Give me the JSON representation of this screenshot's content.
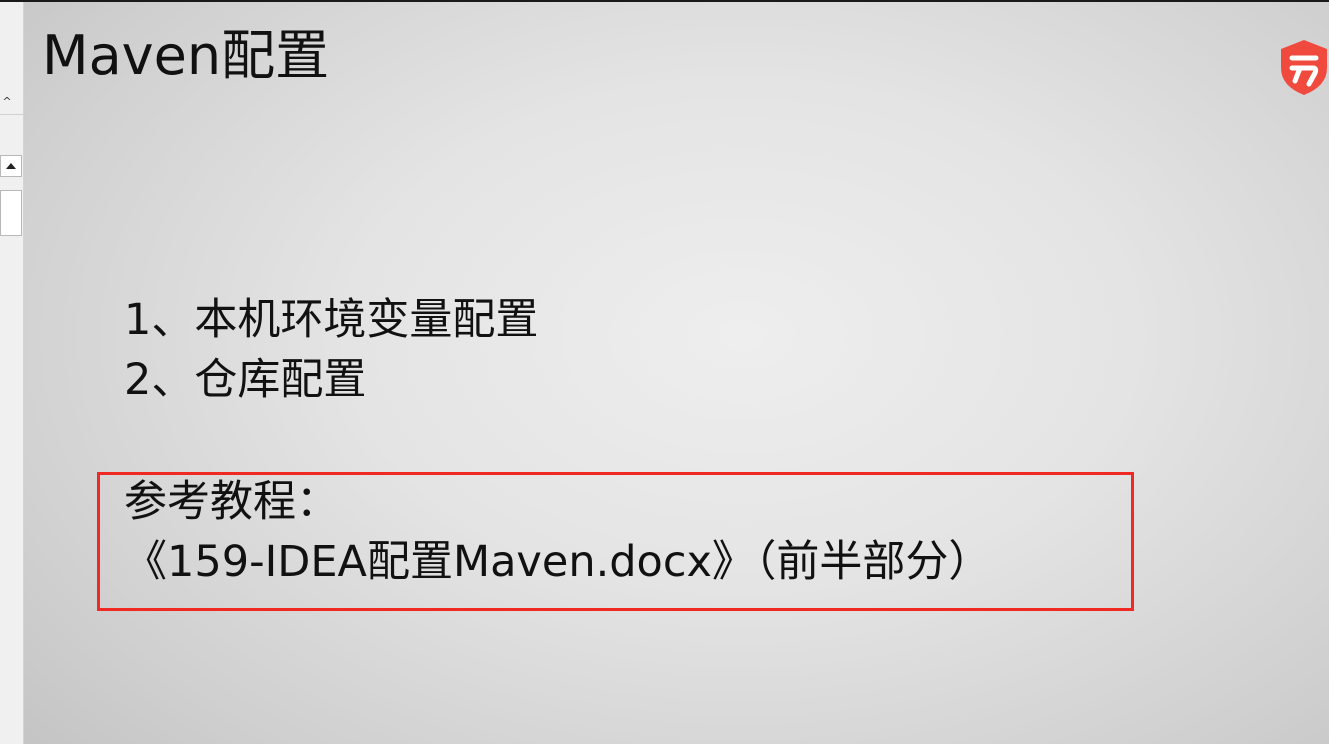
{
  "slide": {
    "title": "Maven配置",
    "items": [
      "1、本机环境变量配置",
      "2、仓库配置"
    ],
    "reference": {
      "label": "参考教程：",
      "document": "《159-IDEA配置Maven.docx》（前半部分）"
    }
  },
  "left_panel": {
    "collapse_glyph": "^"
  },
  "logo": {
    "icon": "shield-logo-icon",
    "color": "#f04a3e"
  },
  "colors": {
    "highlight_box": "#f02a22",
    "text": "#111111"
  }
}
